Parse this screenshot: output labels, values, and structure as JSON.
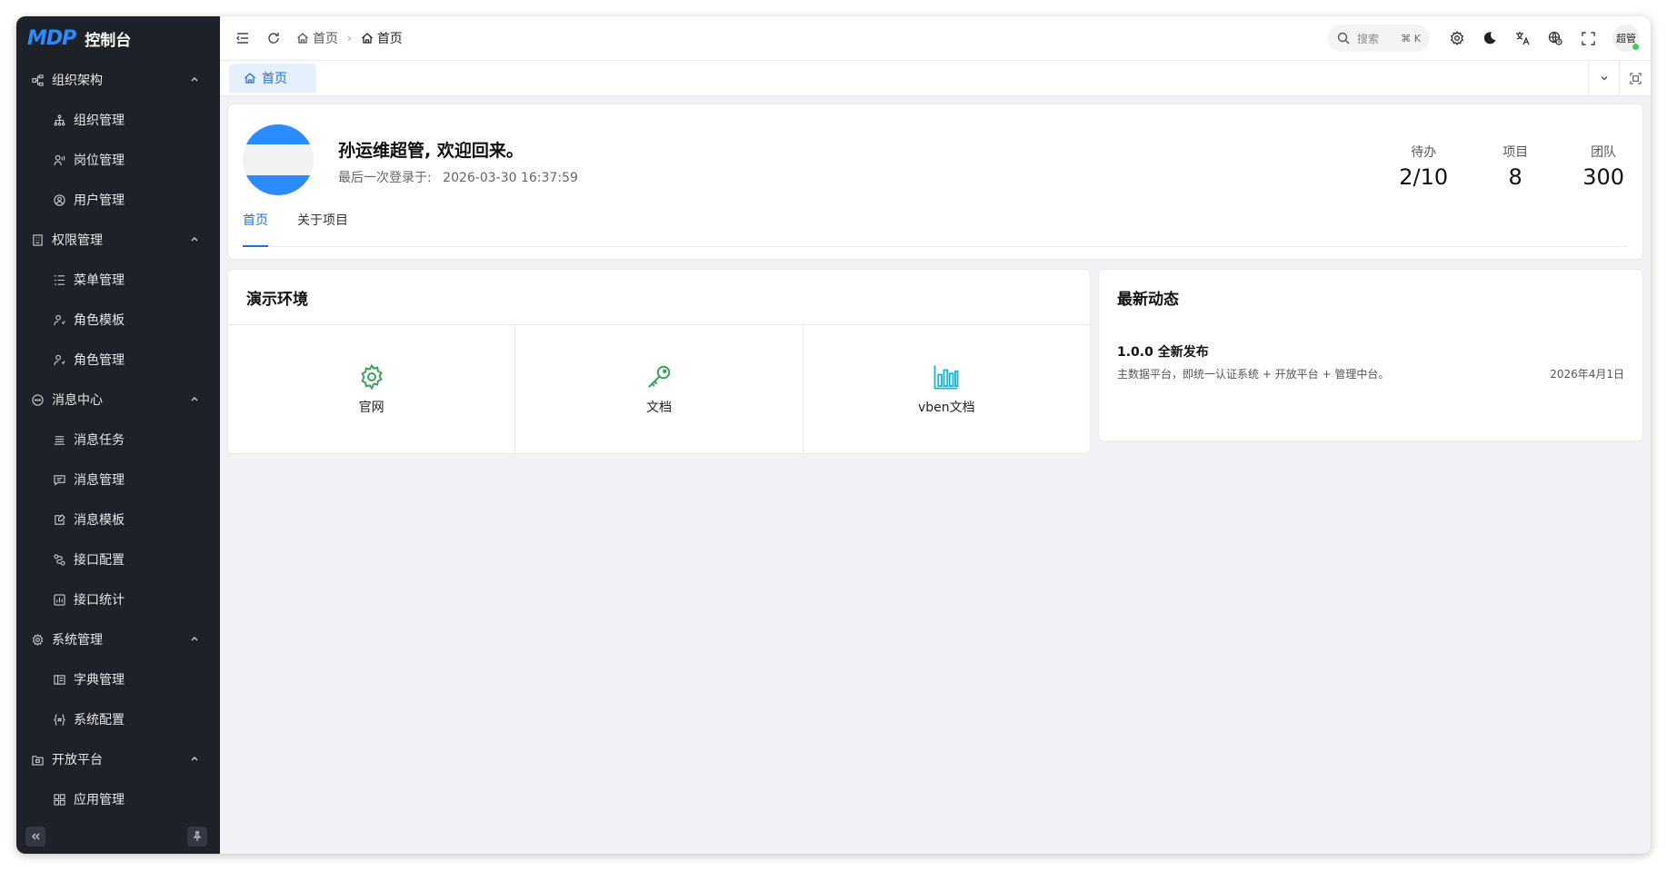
{
  "app": {
    "logo_mark": "MDP",
    "logo_text": "控制台"
  },
  "sidebar": {
    "groups": [
      {
        "label": "组织架构",
        "icon": "org-chart-icon",
        "items": [
          {
            "label": "组织管理",
            "icon": "hierarchy-icon"
          },
          {
            "label": "岗位管理",
            "icon": "user-position-icon"
          },
          {
            "label": "用户管理",
            "icon": "user-circle-icon"
          }
        ]
      },
      {
        "label": "权限管理",
        "icon": "building-icon",
        "items": [
          {
            "label": "菜单管理",
            "icon": "list-icon"
          },
          {
            "label": "角色模板",
            "icon": "user-role-icon"
          },
          {
            "label": "角色管理",
            "icon": "user-role-icon"
          }
        ]
      },
      {
        "label": "消息中心",
        "icon": "message-circle-icon",
        "items": [
          {
            "label": "消息任务",
            "icon": "lines-icon"
          },
          {
            "label": "消息管理",
            "icon": "message-square-icon"
          },
          {
            "label": "消息模板",
            "icon": "template-icon"
          },
          {
            "label": "接口配置",
            "icon": "route-icon"
          },
          {
            "label": "接口统计",
            "icon": "stats-icon"
          }
        ]
      },
      {
        "label": "系统管理",
        "icon": "gear-icon",
        "items": [
          {
            "label": "字典管理",
            "icon": "book-icon"
          },
          {
            "label": "系统配置",
            "icon": "braces-icon"
          }
        ]
      },
      {
        "label": "开放平台",
        "icon": "open-platform-icon",
        "items": [
          {
            "label": "应用管理",
            "icon": "apps-icon"
          }
        ]
      }
    ]
  },
  "header": {
    "breadcrumb": [
      "首页",
      "首页"
    ],
    "search_placeholder": "搜索",
    "search_shortcut": "⌘ K",
    "user_name": "超管"
  },
  "tabs": [
    {
      "label": "首页"
    }
  ],
  "welcome": {
    "title": "孙运维超管, 欢迎回来。",
    "last_login_label": "最后一次登录于:",
    "last_login_time": "2026-03-30 16:37:59",
    "stats": [
      {
        "label": "待办",
        "value": "2/10"
      },
      {
        "label": "项目",
        "value": "8"
      },
      {
        "label": "团队",
        "value": "300"
      }
    ],
    "subtabs": [
      "首页",
      "关于项目"
    ]
  },
  "demo": {
    "title": "演示环境",
    "items": [
      {
        "label": "官网",
        "icon": "gear-icon",
        "color": "#3aa35a"
      },
      {
        "label": "文档",
        "icon": "key-icon",
        "color": "#3aa35a"
      },
      {
        "label": "vben文档",
        "icon": "bar-chart-icon",
        "color": "#1fb6d6"
      }
    ]
  },
  "news": {
    "title": "最新动态",
    "entries": [
      {
        "title": "1.0.0 全新发布",
        "desc": "主数据平台，即统一认证系统 + 开放平台 + 管理中台。",
        "date": "2026年4月1日"
      }
    ]
  },
  "colors": {
    "accent": "#1f6fd6",
    "sidebar_bg": "#1f2128",
    "avatar_blue": "#2a8cff"
  }
}
